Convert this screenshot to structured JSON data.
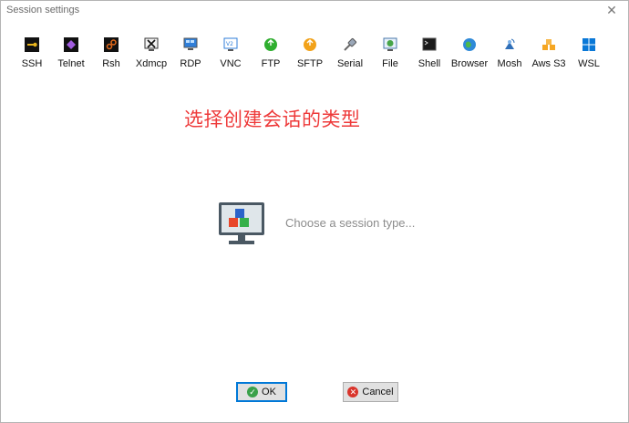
{
  "window": {
    "title": "Session settings",
    "close_glyph": "✕"
  },
  "toolbar": {
    "items": [
      {
        "label": "SSH",
        "icon": "ssh-key-icon"
      },
      {
        "label": "Telnet",
        "icon": "telnet-icon"
      },
      {
        "label": "Rsh",
        "icon": "rsh-icon"
      },
      {
        "label": "Xdmcp",
        "icon": "xdmcp-icon"
      },
      {
        "label": "RDP",
        "icon": "rdp-icon"
      },
      {
        "label": "VNC",
        "icon": "vnc-icon"
      },
      {
        "label": "FTP",
        "icon": "ftp-icon"
      },
      {
        "label": "SFTP",
        "icon": "sftp-icon"
      },
      {
        "label": "Serial",
        "icon": "serial-icon"
      },
      {
        "label": "File",
        "icon": "file-icon"
      },
      {
        "label": "Shell",
        "icon": "shell-icon"
      },
      {
        "label": "Browser",
        "icon": "browser-icon"
      },
      {
        "label": "Mosh",
        "icon": "mosh-icon"
      },
      {
        "label": "Aws S3",
        "icon": "aws-s3-icon"
      },
      {
        "label": "WSL",
        "icon": "wsl-icon"
      }
    ]
  },
  "main": {
    "heading": "选择创建会话的类型",
    "hint": "Choose a session type..."
  },
  "buttons": {
    "ok": "OK",
    "cancel": "Cancel"
  },
  "colors": {
    "heading": "#ee3a3a",
    "hint": "#8c8c8c",
    "ok_border": "#0078d7"
  }
}
